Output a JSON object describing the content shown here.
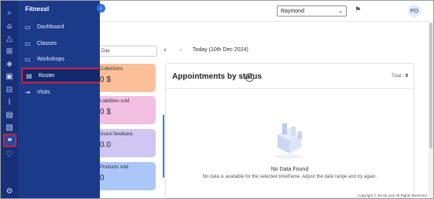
{
  "sidebar": {
    "title": "FitnessI",
    "rail_icons": [
      "search-icon",
      "home-icon",
      "triangle-icon",
      "grid-icon",
      "tag-icon",
      "box-icon",
      "bag-icon",
      "shoe-icon",
      "calendar-icon",
      "document-icon",
      "chart-icon",
      "link-icon",
      "heart-icon",
      "settings-icon"
    ],
    "items": [
      {
        "label": "Dashboard",
        "icon": "dashboard-icon"
      },
      {
        "label": "Classes",
        "icon": "classes-icon"
      },
      {
        "label": "Workshops",
        "icon": "workshops-icon"
      },
      {
        "label": "Roster",
        "icon": "roster-icon"
      },
      {
        "label": "Visits",
        "icon": "visits-icon"
      }
    ]
  },
  "topbar": {
    "user_select": "Raymond",
    "avatar": "PO"
  },
  "filters": {
    "range": "Day",
    "date": "Today (10th Dec 2024)"
  },
  "cards": [
    {
      "label": "Collections",
      "value": "0 $",
      "color": "#fbbf9a"
    },
    {
      "label": "Liabilities sold",
      "value": "0 $",
      "color": "#f2bfe3"
    },
    {
      "label": "Guest feedback",
      "value": "0.0",
      "color": "#cfc6f3"
    },
    {
      "label": "Products sold",
      "value": "0",
      "color": "#abc7fa"
    }
  ],
  "appointments": {
    "title": "Appointments by status",
    "total_label": "Total :",
    "total_value": "0",
    "no_data_title": "No Data Found",
    "no_data_msg": "No data is available for the selected timeframe. Adjust the date range and try again."
  },
  "footer": {
    "copyright": "Copyright © Zenoti.com All Rights Reserved."
  }
}
